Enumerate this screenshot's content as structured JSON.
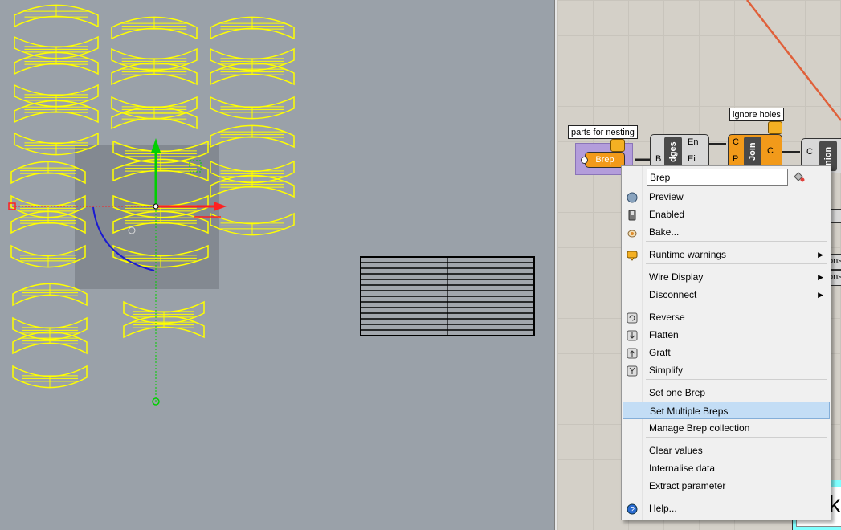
{
  "grasshopper": {
    "brep_param_label": "Brep",
    "group_tooltip": "parts for nesting",
    "join_tooltip": "ignore holes",
    "edges_comp": {
      "label": "dges",
      "in": "B",
      "out1": "En",
      "out2": "Ei"
    },
    "join_comp": {
      "label": "Join",
      "in1": "C",
      "in2": "P",
      "out": "C"
    },
    "union_comp": {
      "label": "nion",
      "in": "C"
    },
    "side_labels": [
      "ons",
      "ons"
    ],
    "bottom_fragment": "k"
  },
  "context_menu": {
    "name_field_value": "Brep",
    "items": [
      {
        "label": "Preview",
        "icon": "preview-sphere-icon"
      },
      {
        "label": "Enabled",
        "icon": "enabled-switch-icon"
      },
      {
        "label": "Bake...",
        "icon": "bake-egg-icon"
      },
      {
        "label": "Runtime warnings",
        "icon": "warning-balloon-icon",
        "submenu": true
      },
      {
        "label": "Wire Display",
        "submenu": true
      },
      {
        "label": "Disconnect",
        "submenu": true
      },
      {
        "label": "Reverse",
        "icon": "reverse-icon"
      },
      {
        "label": "Flatten",
        "icon": "flatten-icon"
      },
      {
        "label": "Graft",
        "icon": "graft-icon"
      },
      {
        "label": "Simplify",
        "icon": "simplify-icon"
      },
      {
        "label": "Set one Brep"
      },
      {
        "label": "Set Multiple Breps",
        "highlighted": true
      },
      {
        "label": "Manage Brep collection"
      },
      {
        "label": "Clear values"
      },
      {
        "label": "Internalise data"
      },
      {
        "label": "Extract parameter"
      },
      {
        "label": "Help...",
        "icon": "help-icon"
      }
    ]
  },
  "colors": {
    "viewport_bg": "#9aa1a9",
    "curve_yellow": "#ffff00",
    "gumball_x": "#ff2020",
    "gumball_y": "#00d000",
    "rotate_arc": "#1a1ad0",
    "component_orange": "#f29a1a",
    "group_purple": "#b39ddb",
    "wire_red": "#e0603a",
    "menu_highlight": "#c3ddf5"
  }
}
